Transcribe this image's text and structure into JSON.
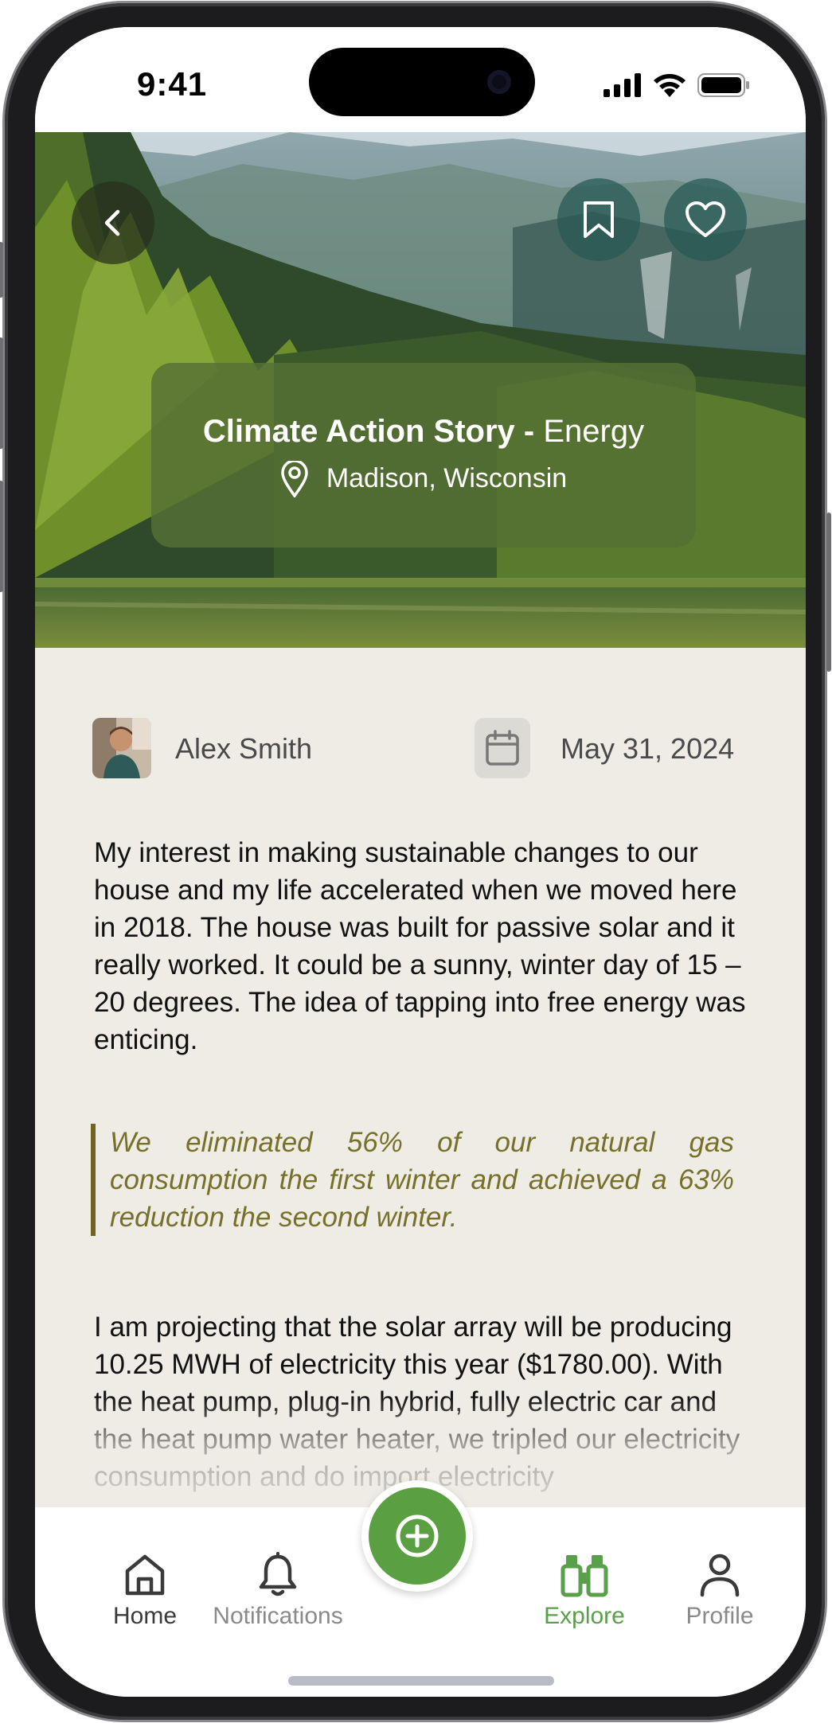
{
  "status_bar": {
    "time": "9:41"
  },
  "hero": {
    "title": "Climate Action Story",
    "separator": " - ",
    "category": "Energy",
    "location": "Madison, Wisconsin"
  },
  "story": {
    "author": "Alex Smith",
    "date": "May 31, 2024",
    "paragraph1": "My interest in making sustainable changes to our house and my life accelerated when we moved here in 2018. The house was built for passive solar and it really worked. It could be a sunny, winter day of 15 – 20 degrees. The idea of tapping into free energy was enticing.",
    "quote": "We eliminated 56% of our natural gas consumption the first winter and achieved a 63% reduction the second winter.",
    "paragraph2": "I am projecting that the solar array will be producing 10.25 MWH of electricity this year ($1780.00).  With the heat pump, plug-in hybrid, fully electric car and the heat pump water heater, we tripled our electricity consumption and do import electricity"
  },
  "nav": {
    "home": "Home",
    "notifications": "Notifications",
    "explore": "Explore",
    "profile": "Profile",
    "active": "Explore"
  },
  "colors": {
    "accent_green": "#5a9f42",
    "quote_olive": "#77702a",
    "card_green": "#567034",
    "background": "#efece5"
  },
  "icons": [
    "back-arrow-icon",
    "bookmark-icon",
    "heart-icon",
    "location-pin-icon",
    "calendar-icon",
    "home-icon",
    "bell-icon",
    "add-circle-icon",
    "binoculars-icon",
    "person-icon",
    "signal-icon",
    "wifi-icon",
    "battery-icon"
  ]
}
